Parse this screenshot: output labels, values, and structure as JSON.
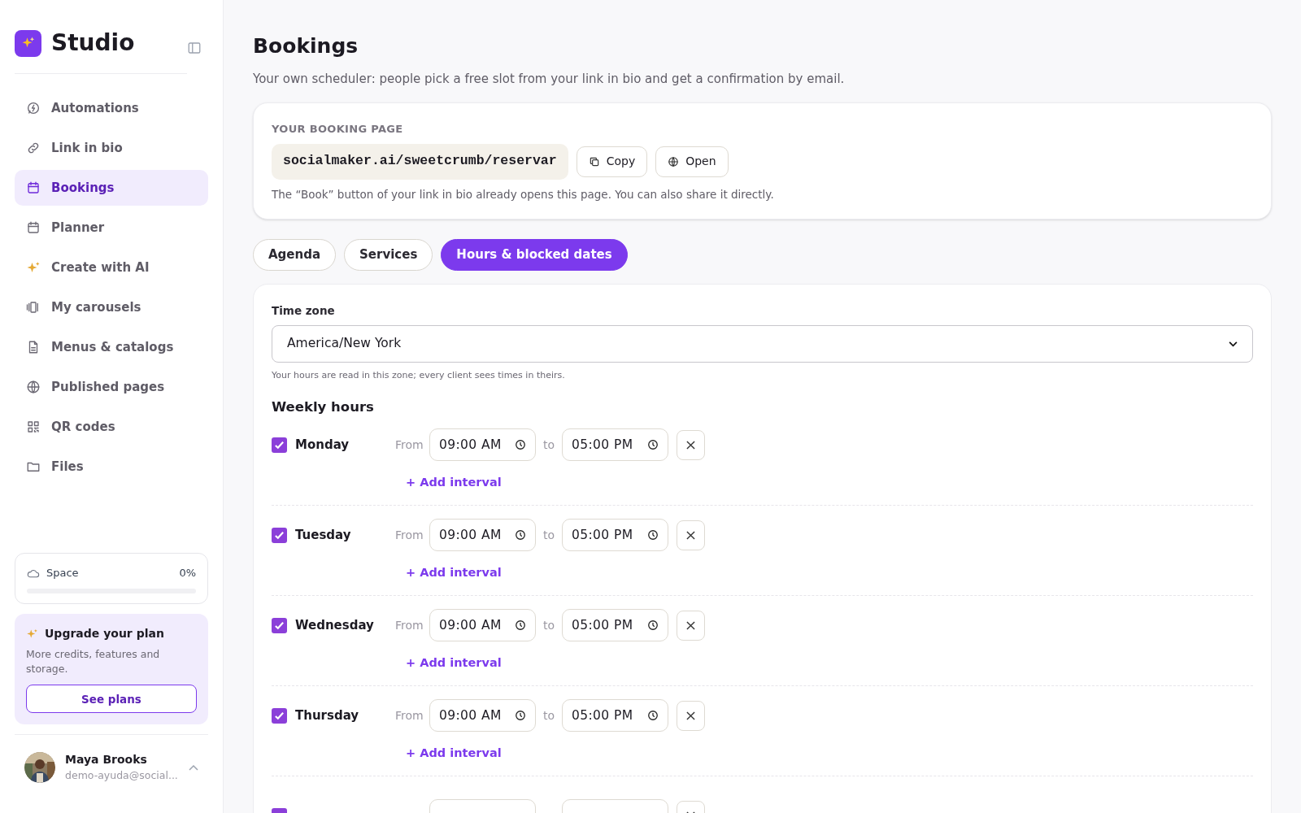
{
  "sidebar": {
    "brand": "Studio",
    "items": [
      {
        "label": "Automations",
        "selected": false
      },
      {
        "label": "Link in bio",
        "selected": false
      },
      {
        "label": "Bookings",
        "selected": true
      },
      {
        "label": "Planner",
        "selected": false
      },
      {
        "label": "Create with AI",
        "selected": false
      },
      {
        "label": "My carousels",
        "selected": false
      },
      {
        "label": "Menus & catalogs",
        "selected": false
      },
      {
        "label": "Published pages",
        "selected": false
      },
      {
        "label": "QR codes",
        "selected": false
      },
      {
        "label": "Files",
        "selected": false
      }
    ],
    "space": {
      "label": "Space",
      "reading": "0%",
      "level": 0
    },
    "upgrade": {
      "title": "Upgrade your plan",
      "text": "More credits, features and storage.",
      "button": "See plans"
    },
    "user": {
      "name": "Maya Brooks",
      "email": "demo-ayuda@social..."
    }
  },
  "page": {
    "title": "Bookings",
    "subtitle": "Your own scheduler: people pick a free slot from your link in bio and get a confirmation by email."
  },
  "booking_card": {
    "heading": "YOUR BOOKING PAGE",
    "url": "socialmaker.ai/sweetcrumb/reservar",
    "copy": "Copy",
    "open": "Open",
    "note": "The “Book” button of your link in bio already opens this page. You can also share it directly."
  },
  "tabs": [
    {
      "label": "Agenda",
      "selected": false
    },
    {
      "label": "Services",
      "selected": false
    },
    {
      "label": "Hours & blocked dates",
      "selected": true
    }
  ],
  "hours": {
    "timezone_label": "Time zone",
    "timezone": "America/New York",
    "timezone_hint": "Your hours are read in this zone; every client sees times in theirs.",
    "weekly_title": "Weekly hours",
    "days": [
      {
        "label": "Monday",
        "checked": true,
        "from_label": "From",
        "from": "09:00 AM",
        "to_label": "to",
        "to": "05:00 PM",
        "add": "+ Add interval"
      },
      {
        "label": "Tuesday",
        "checked": true,
        "from_label": "From",
        "from": "09:00 AM",
        "to_label": "to",
        "to": "05:00 PM",
        "add": "+ Add interval"
      },
      {
        "label": "Wednesday",
        "checked": true,
        "from_label": "From",
        "from": "09:00 AM",
        "to_label": "to",
        "to": "05:00 PM",
        "add": "+ Add interval"
      },
      {
        "label": "Thursday",
        "checked": true,
        "from_label": "From",
        "from": "09:00 AM",
        "to_label": "to",
        "to": "05:00 PM",
        "add": "+ Add interval"
      },
      {
        "checked": true
      }
    ]
  }
}
